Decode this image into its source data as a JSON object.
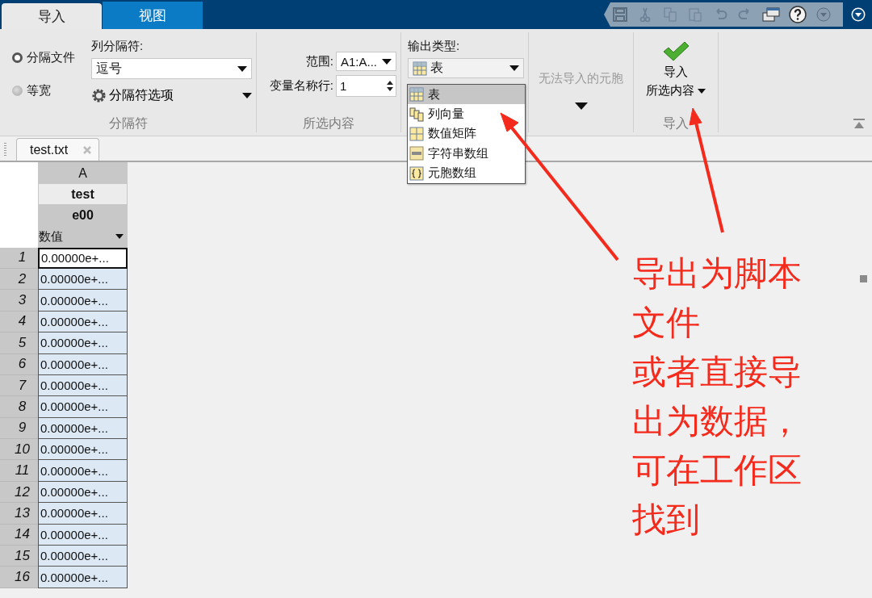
{
  "tabs": [
    {
      "label": "导入",
      "selected": true
    },
    {
      "label": "视图",
      "selected": false
    }
  ],
  "delimiter_section": {
    "title": "分隔符",
    "radios": [
      {
        "label": "分隔文件",
        "selected": true
      },
      {
        "label": "等宽",
        "selected": false
      }
    ],
    "column_delimiter_label": "列分隔符:",
    "column_delimiter_value": "逗号",
    "options_button": "分隔符选项"
  },
  "selection_section": {
    "title": "所选内容",
    "range_label": "范围:",
    "range_value": "A1:A...",
    "header_row_label": "变量名称行:",
    "header_row_value": "1"
  },
  "output_type_section": {
    "label": "输出类型:",
    "value": "表",
    "menu": [
      {
        "label": "表",
        "kind": "table",
        "selected": true
      },
      {
        "label": "列向量",
        "kind": "column-vectors",
        "selected": false
      },
      {
        "label": "数值矩阵",
        "kind": "matrix",
        "selected": false
      },
      {
        "label": "字符串数组",
        "kind": "string-array",
        "selected": false
      },
      {
        "label": "元胞数组",
        "kind": "cell-array",
        "selected": false
      }
    ]
  },
  "unimportable_section": {
    "label": "无法导入的元胞"
  },
  "import_section": {
    "title": "导入",
    "button_line_1": "导入",
    "button_line_2": "所选内容"
  },
  "document_tabs": [
    {
      "label": "test.txt"
    }
  ],
  "table": {
    "column_letter": "A",
    "column_name": "test",
    "column_name_2": "e00",
    "column_type": "数值",
    "rows": [
      {
        "number": "1",
        "value": "0.00000e+...",
        "selected": true
      },
      {
        "number": "2",
        "value": "0.00000e+...",
        "selected": false
      },
      {
        "number": "3",
        "value": "0.00000e+...",
        "selected": false
      },
      {
        "number": "4",
        "value": "0.00000e+...",
        "selected": false
      },
      {
        "number": "5",
        "value": "0.00000e+...",
        "selected": false
      },
      {
        "number": "6",
        "value": "0.00000e+...",
        "selected": false
      },
      {
        "number": "7",
        "value": "0.00000e+...",
        "selected": false
      },
      {
        "number": "8",
        "value": "0.00000e+...",
        "selected": false
      },
      {
        "number": "9",
        "value": "0.00000e+...",
        "selected": false
      },
      {
        "number": "10",
        "value": "0.00000e+...",
        "selected": false
      },
      {
        "number": "11",
        "value": "0.00000e+...",
        "selected": false
      },
      {
        "number": "12",
        "value": "0.00000e+...",
        "selected": false
      },
      {
        "number": "13",
        "value": "0.00000e+...",
        "selected": false
      },
      {
        "number": "14",
        "value": "0.00000e+...",
        "selected": false
      },
      {
        "number": "15",
        "value": "0.00000e+...",
        "selected": false
      },
      {
        "number": "16",
        "value": "0.00000e+...",
        "selected": false
      }
    ]
  },
  "annotation": {
    "lines": [
      "导出为脚本",
      "文件",
      "或者直接导",
      "出为数据，",
      "可在工作区",
      "找到"
    ]
  }
}
